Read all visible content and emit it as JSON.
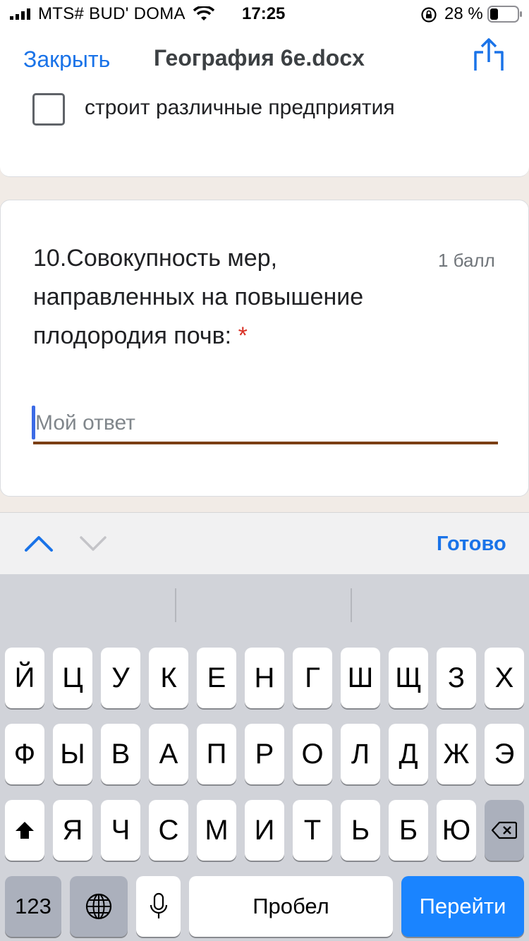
{
  "status_bar": {
    "carrier": "MTS# BUD' DOMA",
    "time": "17:25",
    "battery": "28 %"
  },
  "nav": {
    "close_label": "Закрыть",
    "title": "География 6е.docx",
    "share_icon": "share-icon"
  },
  "prev_question": {
    "option_label": "строит различные предприятия"
  },
  "question": {
    "text": "10.Совокупность мер, направленных на повышение плодородия почв:",
    "required_mark": "*",
    "points": "1 балл",
    "answer_placeholder": "Мой ответ",
    "answer_value": ""
  },
  "accessory": {
    "done_label": "Готово"
  },
  "keyboard": {
    "row1": [
      "Й",
      "Ц",
      "У",
      "К",
      "Е",
      "Н",
      "Г",
      "Ш",
      "Щ",
      "З",
      "Х"
    ],
    "row2": [
      "Ф",
      "Ы",
      "В",
      "А",
      "П",
      "Р",
      "О",
      "Л",
      "Д",
      "Ж",
      "Э"
    ],
    "row3": [
      "Я",
      "Ч",
      "С",
      "М",
      "И",
      "Т",
      "Ь",
      "Б",
      "Ю"
    ],
    "numbers_label": "123",
    "space_label": "Пробел",
    "go_label": "Перейти"
  },
  "colors": {
    "accent": "#1a73e8",
    "answer_underline": "#7b3f14",
    "required": "#d93025",
    "go_key": "#1a84ff"
  }
}
